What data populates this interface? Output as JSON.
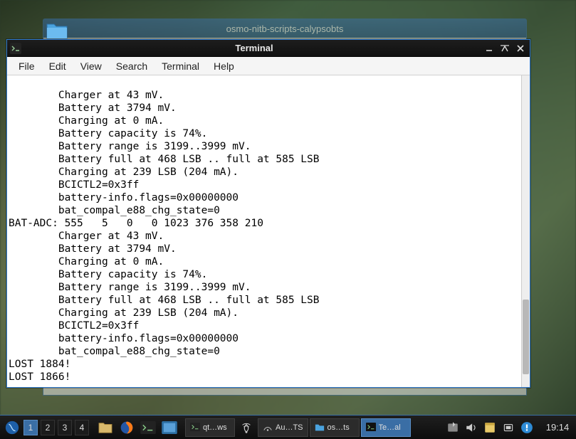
{
  "bg_window": {
    "title": "osmo-nitb-scripts-calypsobts"
  },
  "window": {
    "title": "Terminal",
    "menu": {
      "file": "File",
      "edit": "Edit",
      "view": "View",
      "search": "Search",
      "terminal": "Terminal",
      "help": "Help"
    }
  },
  "terminal_lines": [
    "        Charger at 43 mV.",
    "        Battery at 3794 mV.",
    "        Charging at 0 mA.",
    "        Battery capacity is 74%.",
    "        Battery range is 3199..3999 mV.",
    "        Battery full at 468 LSB .. full at 585 LSB",
    "        Charging at 239 LSB (204 mA).",
    "        BCICTL2=0x3ff",
    "        battery-info.flags=0x00000000",
    "        bat_compal_e88_chg_state=0",
    "BAT-ADC: 555   5   0   0 1023 376 358 210",
    "        Charger at 43 mV.",
    "        Battery at 3794 mV.",
    "        Charging at 0 mA.",
    "        Battery capacity is 74%.",
    "        Battery range is 3199..3999 mV.",
    "        Battery full at 468 LSB .. full at 585 LSB",
    "        Charging at 239 LSB (204 mA).",
    "        BCICTL2=0x3ff",
    "        battery-info.flags=0x00000000",
    "        bat_compal_e88_chg_state=0",
    "LOST 1884!",
    "LOST 1866!"
  ],
  "taskbar": {
    "workspaces": [
      "1",
      "2",
      "3",
      "4"
    ],
    "active_workspace": 0,
    "tasks": [
      {
        "icon": "terminal",
        "label": "qt…ws",
        "active": false
      },
      {
        "icon": "network",
        "label": "Au…TS",
        "active": false
      },
      {
        "icon": "folder",
        "label": "os…ts",
        "active": false
      },
      {
        "icon": "terminal",
        "label": "Te…al",
        "active": true
      }
    ],
    "clock": "19:14"
  }
}
